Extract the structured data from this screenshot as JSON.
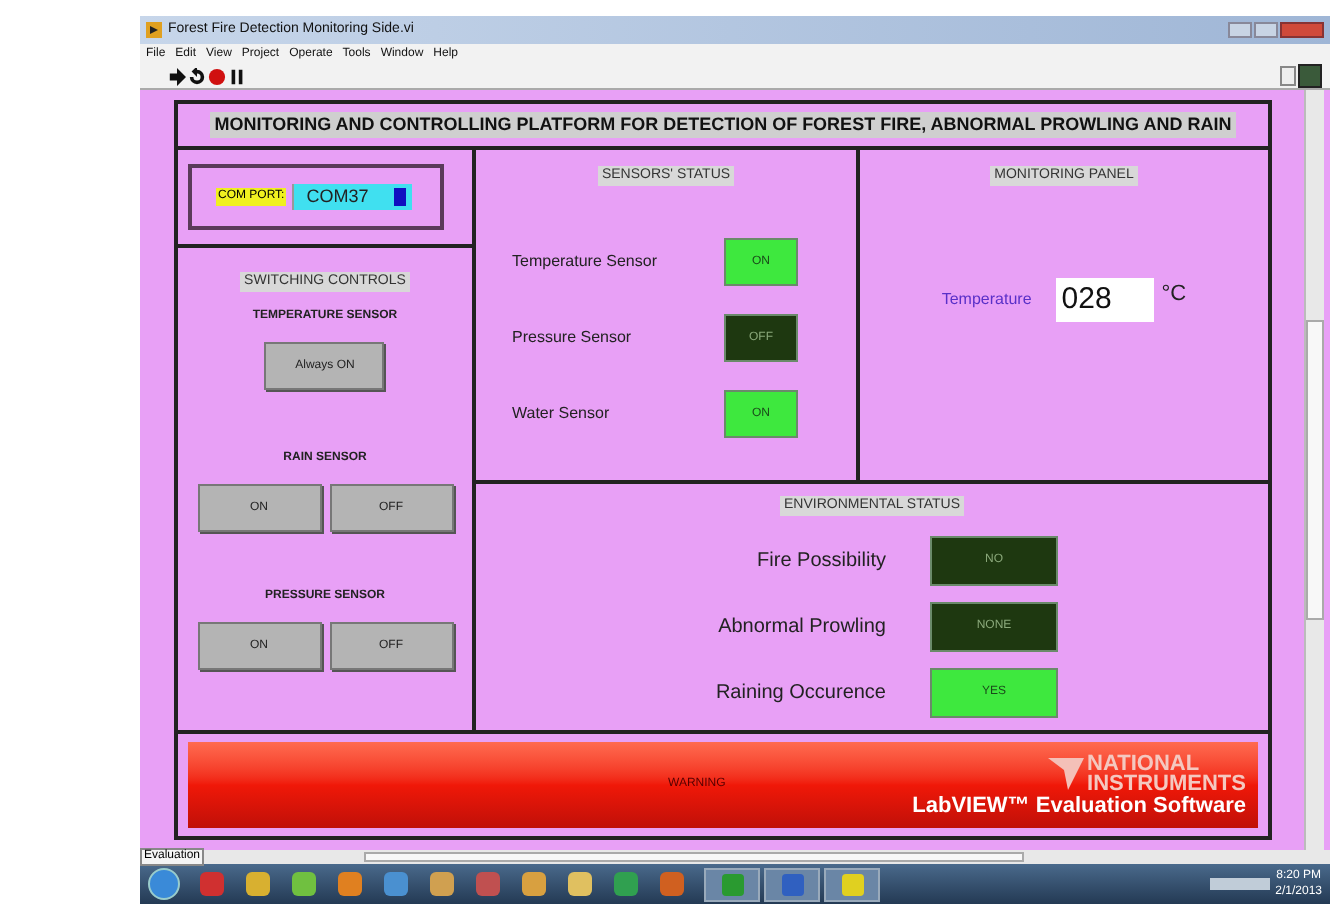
{
  "window": {
    "title": "Forest Fire Detection Monitoring Side.vi"
  },
  "menu": [
    "File",
    "Edit",
    "View",
    "Project",
    "Operate",
    "Tools",
    "Window",
    "Help"
  ],
  "toolbar": [
    {
      "kind": "run"
    },
    {
      "kind": "continuous"
    },
    {
      "kind": "abort"
    },
    {
      "kind": "pause"
    }
  ],
  "header": "MONITORING AND CONTROLLING PLATFORM FOR DETECTION OF FOREST FIRE, ABNORMAL PROWLING AND RAIN",
  "com_port": {
    "label": "COM PORT:",
    "value": "COM37"
  },
  "switching": {
    "title": "SWITCHING CONTROLS",
    "groups": [
      {
        "label": "TEMPERATURE SENSOR",
        "buttons": [
          "Always ON"
        ]
      },
      {
        "label": "RAIN SENSOR",
        "buttons": [
          "ON",
          "OFF"
        ]
      },
      {
        "label": "PRESSURE SENSOR",
        "buttons": [
          "ON",
          "OFF"
        ]
      }
    ]
  },
  "sensors": {
    "title": "SENSORS' STATUS",
    "items": [
      {
        "label": "Temperature Sensor",
        "led": "ON",
        "on": true
      },
      {
        "label": "Pressure Sensor",
        "led": "OFF",
        "on": false
      },
      {
        "label": "Water Sensor",
        "led": "ON",
        "on": true
      }
    ]
  },
  "monitoring": {
    "title": "MONITORING PANEL",
    "label": "Temperature",
    "value": "028",
    "unit": "°C"
  },
  "environment": {
    "title": "ENVIRONMENTAL STATUS",
    "items": [
      {
        "label": "Fire Possibility",
        "led": "NO",
        "on": false
      },
      {
        "label": "Abnormal Prowling",
        "led": "NONE",
        "on": false
      },
      {
        "label": "Raining Occurence",
        "led": "YES",
        "on": true
      }
    ]
  },
  "warning": {
    "label": "WARNING",
    "on": true
  },
  "branding": {
    "line1": "NATIONAL",
    "line2": "INSTRUMENTS",
    "line3": "LabVIEW™ Evaluation Software"
  },
  "evaluation_tab": "Evaluation",
  "taskbar": {
    "time": "8:20 PM",
    "date": "2/1/2013"
  }
}
